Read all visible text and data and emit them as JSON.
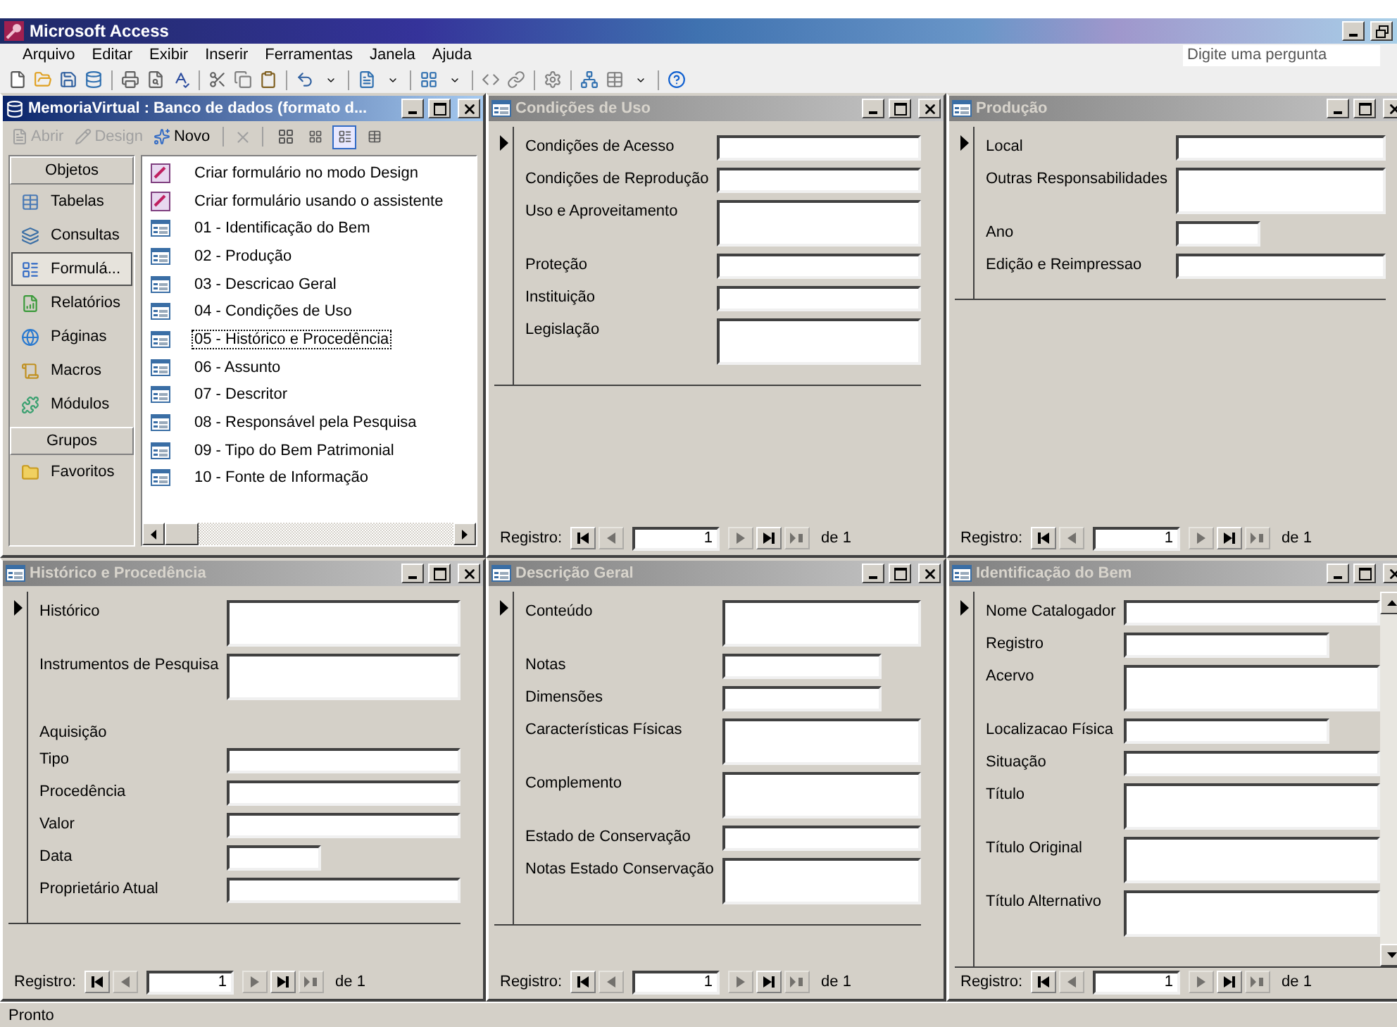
{
  "app": {
    "title": "Microsoft Access",
    "active": true
  },
  "menu": [
    {
      "label": "Arquivo"
    },
    {
      "label": "Editar"
    },
    {
      "label": "Exibir"
    },
    {
      "label": "Inserir"
    },
    {
      "label": "Ferramentas"
    },
    {
      "label": "Janela"
    },
    {
      "label": "Ajuda"
    }
  ],
  "ask_box": {
    "placeholder": "Digite uma pergunta"
  },
  "db_window": {
    "title": "MemoriaVirtual : Banco de dados (formato d...",
    "active": true,
    "toolbar": [
      {
        "label": "Abrir",
        "disabled": true
      },
      {
        "label": "Design",
        "disabled": true
      },
      {
        "label": "Novo",
        "disabled": false
      }
    ],
    "view_buttons": [
      {
        "selected": false
      },
      {
        "selected": false
      },
      {
        "selected": true
      },
      {
        "selected": false
      }
    ],
    "objects_header": "Objetos",
    "objects": [
      {
        "label": "Tabelas",
        "selected": false
      },
      {
        "label": "Consultas",
        "selected": false
      },
      {
        "label": "Formulá...",
        "selected": true
      },
      {
        "label": "Relatórios",
        "selected": false
      },
      {
        "label": "Páginas",
        "selected": false
      },
      {
        "label": "Macros",
        "selected": false
      },
      {
        "label": "Módulos",
        "selected": false
      }
    ],
    "groups_header": "Grupos",
    "groups": [
      {
        "label": "Favoritos"
      }
    ],
    "items": [
      {
        "label": "Criar formulário no modo Design",
        "kind": "wizard",
        "focused": false
      },
      {
        "label": "Criar formulário usando o assistente",
        "kind": "wizard",
        "focused": false
      },
      {
        "label": "01 - Identificação do Bem",
        "kind": "form",
        "focused": false
      },
      {
        "label": "02 - Produção",
        "kind": "form",
        "focused": false
      },
      {
        "label": "03 - Descricao Geral",
        "kind": "form",
        "focused": false
      },
      {
        "label": "04 - Condições de Uso",
        "kind": "form",
        "focused": false
      },
      {
        "label": "05 - Histórico e Procedência",
        "kind": "form",
        "focused": true
      },
      {
        "label": "06 - Assunto",
        "kind": "form",
        "focused": false
      },
      {
        "label": "07 - Descritor",
        "kind": "form",
        "focused": false
      },
      {
        "label": "08 - Responsável pela Pesquisa",
        "kind": "form",
        "focused": false
      },
      {
        "label": "09 - Tipo do Bem Patrimonial",
        "kind": "form",
        "focused": false
      },
      {
        "label": "10 - Fonte de Informação",
        "kind": "form",
        "focused": false
      }
    ]
  },
  "forms": [
    {
      "title": "Condições de Uso",
      "active": false,
      "fields": [
        {
          "label": "Condições de Acesso",
          "kind": "field"
        },
        {
          "label": "Condições de Reprodução",
          "kind": "field"
        },
        {
          "label": "Uso e Aproveitamento",
          "kind": "memo"
        },
        {
          "label": "Proteção",
          "kind": "field"
        },
        {
          "label": "Instituição",
          "kind": "field"
        },
        {
          "label": "Legislação",
          "kind": "memo"
        }
      ],
      "nav": {
        "label": "Registro:",
        "current": "1",
        "of": "de",
        "total": "1"
      }
    },
    {
      "title": "Produção",
      "active": false,
      "fields": [
        {
          "label": "Local",
          "kind": "field"
        },
        {
          "label": "Outras Responsabilidades",
          "kind": "memo"
        },
        {
          "label": "Ano",
          "kind": "short"
        },
        {
          "label": "Edição e Reimpressao",
          "kind": "field"
        }
      ],
      "nav": {
        "label": "Registro:",
        "current": "1",
        "of": "de",
        "total": "1"
      }
    },
    {
      "title": "Histórico e Procedência",
      "active": false,
      "fields": [
        {
          "label": "Histórico",
          "kind": "memo"
        },
        {
          "label": "Instrumentos de Pesquisa",
          "kind": "memo"
        },
        {
          "label": "Aquisição",
          "kind": "heading"
        },
        {
          "label": "Tipo",
          "kind": "field"
        },
        {
          "label": "Procedência",
          "kind": "field"
        },
        {
          "label": "Valor",
          "kind": "field"
        },
        {
          "label": "Data",
          "kind": "short"
        },
        {
          "label": "Proprietário Atual",
          "kind": "field"
        }
      ],
      "nav": {
        "label": "Registro:",
        "current": "1",
        "of": "de",
        "total": "1"
      }
    },
    {
      "title": "Descrição Geral",
      "active": false,
      "fields": [
        {
          "label": "Conteúdo",
          "kind": "memo"
        },
        {
          "label": "Notas",
          "kind": "medium"
        },
        {
          "label": "Dimensões",
          "kind": "medium"
        },
        {
          "label": "Características Físicas",
          "kind": "memo"
        },
        {
          "label": "Complemento",
          "kind": "memo"
        },
        {
          "label": "Estado de Conservação",
          "kind": "field"
        },
        {
          "label": "Notas Estado Conservação",
          "kind": "memo"
        }
      ],
      "nav": {
        "label": "Registro:",
        "current": "1",
        "of": "de",
        "total": "1"
      }
    },
    {
      "title": "Identificação do Bem",
      "active": false,
      "has_scrollbar": true,
      "fields": [
        {
          "label": "Nome Catalogador",
          "kind": "field"
        },
        {
          "label": "Registro",
          "kind": "medium"
        },
        {
          "label": "Acervo",
          "kind": "memo"
        },
        {
          "label": "Localizacao Física",
          "kind": "medium"
        },
        {
          "label": "Situação",
          "kind": "field"
        },
        {
          "label": "Título",
          "kind": "memo"
        },
        {
          "label": "Título Original",
          "kind": "memo"
        },
        {
          "label": "Título Alternativo",
          "kind": "memo"
        }
      ],
      "nav": {
        "label": "Registro:",
        "current": "1",
        "of": "de",
        "total": "1"
      }
    }
  ],
  "status_bar": "Pronto"
}
